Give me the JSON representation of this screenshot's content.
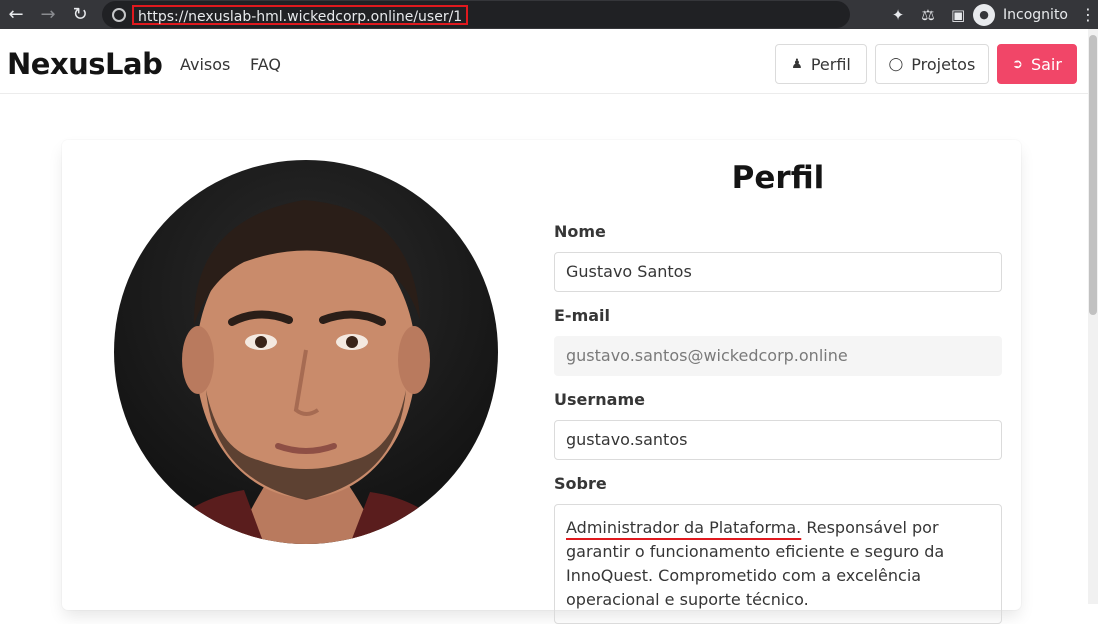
{
  "browser": {
    "url": "https://nexuslab-hml.wickedcorp.online/user/1",
    "profile_label": "Incognito"
  },
  "navbar": {
    "brand": "NexusLab",
    "links": [
      "Avisos",
      "FAQ"
    ],
    "buttons": {
      "profile": "Perfil",
      "projects": "Projetos",
      "logout": "Sair"
    }
  },
  "profile": {
    "title": "Perfil",
    "name_label": "Nome",
    "name_value": "Gustavo Santos",
    "email_label": "E-mail",
    "email_value": "gustavo.santos@wickedcorp.online",
    "username_label": "Username",
    "username_value": "gustavo.santos",
    "about_label": "Sobre",
    "about_highlight": "Administrador da Plataforma.",
    "about_rest": " Responsável por garantir o funcionamento eficiente e seguro da InnoQuest. Comprometido com a excelência operacional e suporte técnico."
  },
  "colors": {
    "danger": "#f14668",
    "annotation": "#e0191e",
    "chrome_bg": "#35363a"
  }
}
